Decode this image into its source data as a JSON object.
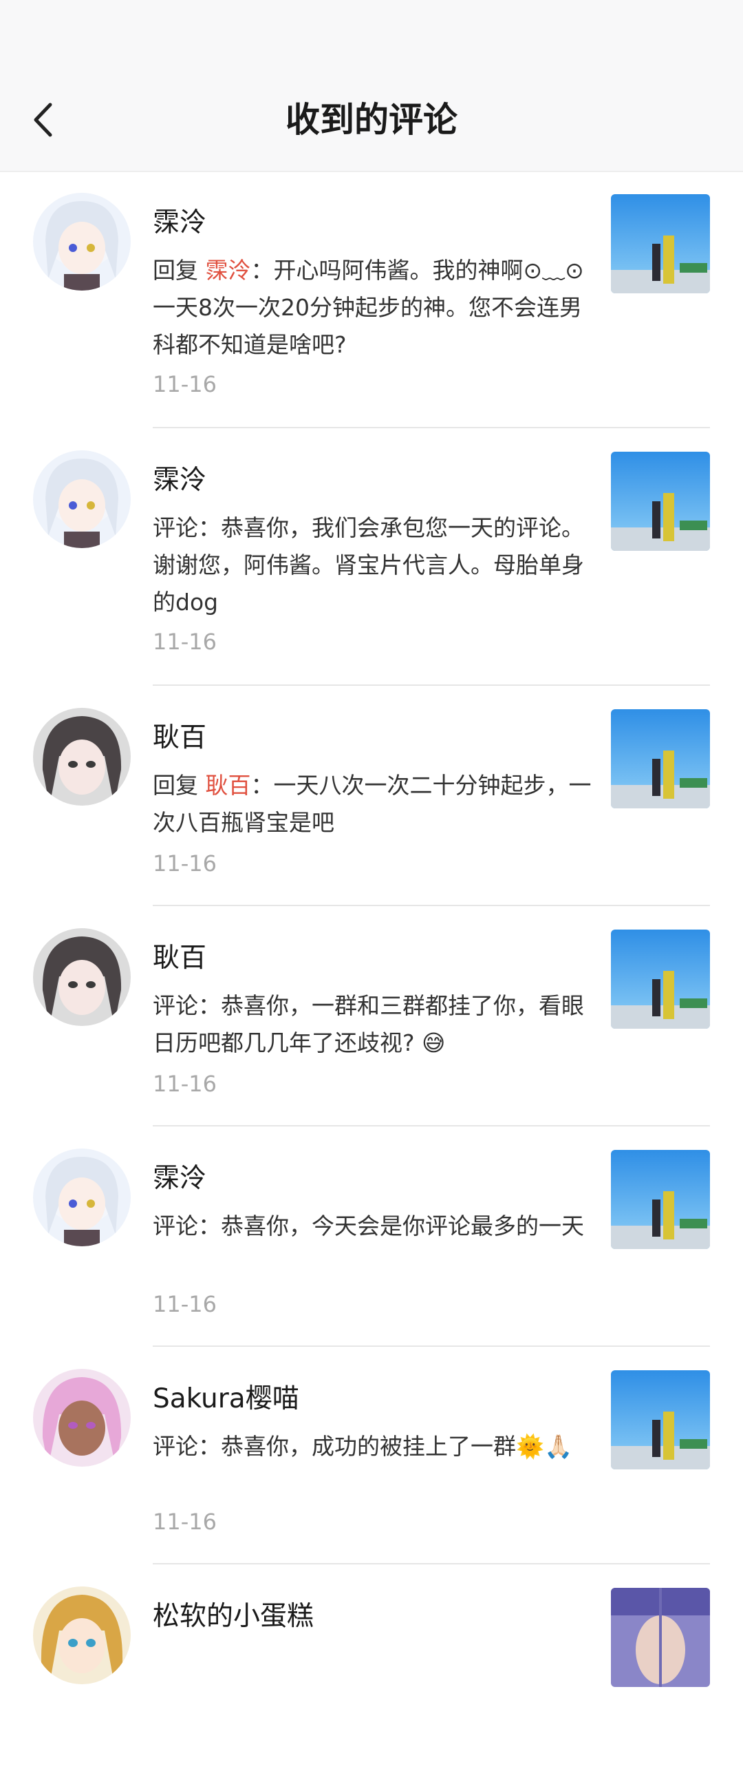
{
  "header": {
    "title": "收到的评论",
    "back_icon": "chevron-left-icon"
  },
  "comments": [
    {
      "name": "霂泠",
      "prefix": "回复 ",
      "target": "霂泠",
      "body": "：开心吗阿伟酱。我的神啊⊙﹏⊙一天8次一次20分钟起步的神。您不会连男科都不知道是啥吧?",
      "date": "11-16",
      "avatar": "white-haired-anime-avatar"
    },
    {
      "name": "霂泠",
      "prefix": "",
      "target": "",
      "body": "评论：恭喜你，我们会承包您一天的评论。谢谢您，阿伟酱。肾宝片代言人。母胎单身的dog",
      "date": "11-16",
      "avatar": "white-haired-anime-avatar"
    },
    {
      "name": "耿百",
      "prefix": "回复 ",
      "target": "耿百",
      "body": "：一天八次一次二十分钟起步，一次八百瓶肾宝是吧",
      "date": "11-16",
      "avatar": "dark-haired-anime-avatar"
    },
    {
      "name": "耿百",
      "prefix": "",
      "target": "",
      "body": "评论：恭喜你，一群和三群都挂了你，看眼日历吧都几几年了还歧视? 😅",
      "date": "11-16",
      "avatar": "dark-haired-anime-avatar"
    },
    {
      "name": "霂泠",
      "prefix": "",
      "target": "",
      "body": "评论：恭喜你，今天会是你评论最多的一天",
      "date": "11-16",
      "avatar": "white-haired-anime-avatar"
    },
    {
      "name": "Sakura樱喵",
      "prefix": "",
      "target": "",
      "body": "评论：恭喜你，成功的被挂上了一群🌞🙏🏻",
      "date": "11-16",
      "avatar": "pink-haired-anime-avatar"
    },
    {
      "name": "松软的小蛋糕",
      "prefix": "",
      "target": "",
      "body": "",
      "date": "",
      "avatar": "blonde-anime-avatar"
    }
  ],
  "colors": {
    "reply_target": "#e0503f",
    "date": "#a8a8a8",
    "header_bg": "#f8f8f9"
  }
}
